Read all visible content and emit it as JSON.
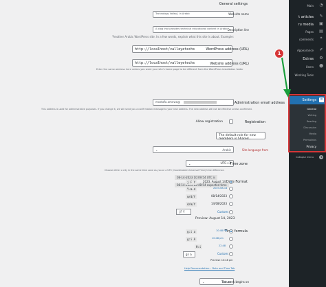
{
  "page_title": "General settings",
  "fields": {
    "site_title": {
      "label": "Web site name",
      "value": "Technology Valley | In Arabic"
    },
    "tagline": {
      "label": "Description line",
      "value": "A blog that provides technical educational content in Arabic",
      "desc": "“Another Arabic WordPress site. In a few words, explain what this site is about. Example:"
    },
    "wp_address": {
      "label": "WordPress address (URL)",
      "value": "http://localhost/valleyetechs"
    },
    "site_address": {
      "label": "Website address (URL)",
      "value": "http://localhost/valleyetechs",
      "desc": "Enter the same address here unless you want your site's home page to be different from the WordPress installation folder"
    },
    "admin_email": {
      "label": "Administration email address",
      "value": "mostafa.amewa@",
      "desc": "This address is used for administrative purposes. If you change it, we will send you a confirmation message to your new address. The new address will not be effective unless confirmed."
    },
    "membership": {
      "label": "Registration",
      "checkbox_label": "Allow registration"
    },
    "default_role": {
      "label": "The default role for new members is Shared..",
      "value": ""
    },
    "language": {
      "label": "Site language from",
      "value": "Arabic"
    },
    "timezone": {
      "label": "Time zone",
      "value": "UTC+3",
      "desc": "Choose either a city in the same time zone as you or a UTC (Coordinated Universal Time) time difference.",
      "utc_time": "08-14-2023 10:09:54 UTC is",
      "local_time": "08-14-2023 22:48:54 expected time"
    },
    "date_format": {
      "label": "Date Format",
      "options": [
        {
          "text": "2023, August 14",
          "code": "j F Y",
          "checked": true
        },
        {
          "text": "2023-08-14",
          "code": "Y-m-d",
          "checked": false
        },
        {
          "text": "08/14/2023",
          "code": "m/d/Y",
          "checked": false
        },
        {
          "text": "14/08/2023",
          "code": "d/m/Y",
          "checked": false
        }
      ],
      "custom_label": "Custom:",
      "custom_value": "j F Y",
      "preview": "Preview: August 14, 2023"
    },
    "time_format": {
      "label": "Time formula",
      "options": [
        {
          "text": "10:48 PM",
          "code": "g:i a",
          "checked": true
        },
        {
          "text": "10:48 pm",
          "code": "g:i A",
          "checked": false
        },
        {
          "text": "22:48",
          "code": "H:i",
          "checked": false
        }
      ],
      "custom_label": "Custom:",
      "custom_value": "g:i a",
      "preview": "Preview: 10:48 pm",
      "help": "Help Documentation... Date and Time Tab"
    },
    "week_start": {
      "label": "The week begins on",
      "value": "Saturn"
    }
  },
  "sidebar": {
    "top_items": [
      {
        "label": "Main",
        "icon": "dashboard-icon"
      },
      {
        "label": "t articles",
        "icon": "pin-icon"
      },
      {
        "label": "ru media",
        "icon": "media-icon"
      },
      {
        "label": "Pages",
        "icon": "page-icon"
      },
      {
        "label": "comments",
        "icon": "comment-icon"
      }
    ],
    "mid_items": [
      {
        "label": "Appearance",
        "icon": "brush-icon"
      },
      {
        "label": "Extras",
        "icon": "plugin-icon"
      },
      {
        "label": "Users",
        "icon": "user-icon"
      },
      {
        "label": "Working Tools",
        "icon": "wrench-icon"
      }
    ],
    "settings_label": "Settings",
    "sub_items": [
      "General",
      "Writing",
      "Reading",
      "Discussion",
      "Media",
      "Permalinks",
      "Privacy"
    ],
    "collapse_label": "Collapse menu"
  },
  "annotation": {
    "badge": "1"
  },
  "colors": {
    "accent": "#2271b1",
    "sidebar_bg": "#1d2327",
    "highlight": "#d63638",
    "arrow": "#1a9e3c"
  }
}
